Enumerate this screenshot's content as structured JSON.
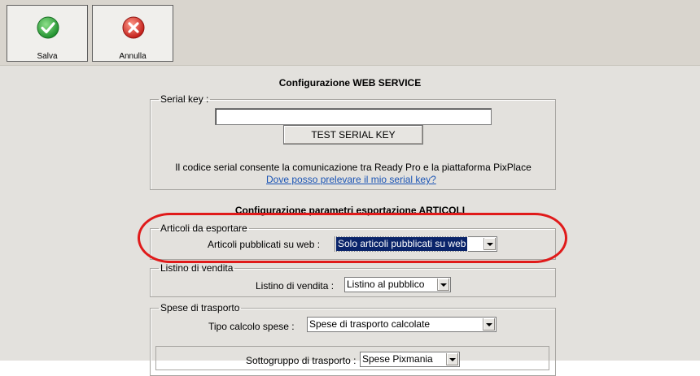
{
  "toolbar": {
    "save_label": "Salva",
    "cancel_label": "Annulla",
    "save_icon_color": "#2fa83a",
    "cancel_icon_color": "#d8332c"
  },
  "page": {
    "title": "Configurazione WEB SERVICE",
    "articles_title": "Configurazione parametri esportazione ARTICOLI"
  },
  "serial": {
    "legend": "Serial key :",
    "value": "",
    "test_button": "TEST SERIAL KEY",
    "info": "Il codice serial consente la comunicazione tra Ready Pro e la piattaforma PixPlace",
    "link": "Dove posso prelevare il mio serial key?"
  },
  "articles": {
    "legend": "Articoli da esportare",
    "label": "Articoli pubblicati su web :",
    "selected": "Solo articoli pubblicati su web"
  },
  "price_list": {
    "legend": "Listino di vendita",
    "label": "Listino di vendita :",
    "selected": "Listino al pubblico"
  },
  "shipping": {
    "legend": "Spese di trasporto",
    "label": "Tipo calcolo spese :",
    "selected": "Spese di trasporto calcolate",
    "sub_label": "Sottogruppo di trasporto :",
    "sub_selected": "Spese Pixmania"
  },
  "annotation_color": "#e01a1a"
}
